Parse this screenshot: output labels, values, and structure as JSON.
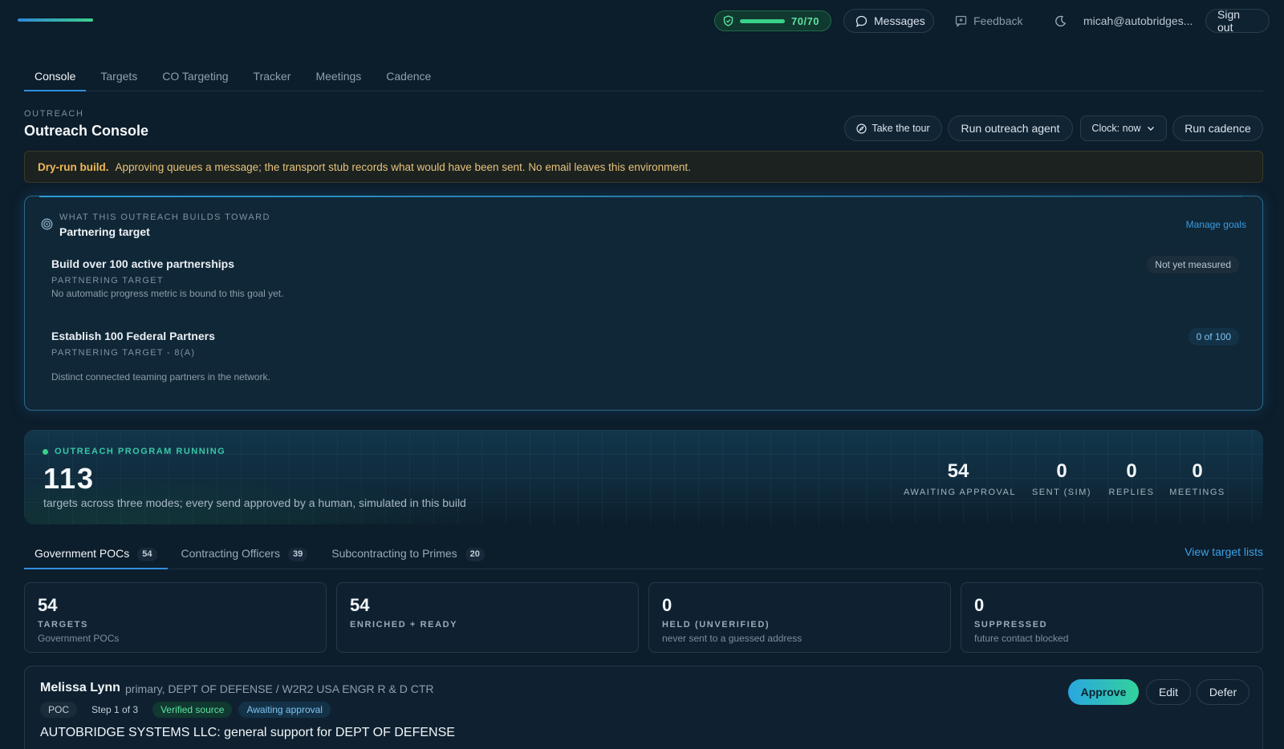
{
  "header": {
    "score": "70/70",
    "score_fill": 1.0,
    "messages_label": "Messages",
    "feedback_label": "Feedback",
    "user_email": "micah@autobridges...",
    "signout_label": "Sign out"
  },
  "tabs": [
    "Console",
    "Targets",
    "CO Targeting",
    "Tracker",
    "Meetings",
    "Cadence"
  ],
  "page": {
    "eyebrow": "OUTREACH",
    "title": "Outreach Console",
    "tour_label": "Take the tour",
    "run_agent_label": "Run outreach agent",
    "clock_label": "Clock: now",
    "run_cadence_label": "Run cadence"
  },
  "notice": {
    "title": "Dry-run build.",
    "text": "Approving queues a message; the transport stub records what would have been sent. No email leaves this environment."
  },
  "goals": {
    "subtitle": "WHAT THIS OUTREACH BUILDS TOWARD",
    "title": "Partnering target",
    "manage_label": "Manage goals",
    "items": [
      {
        "name": "Build over 100 active partnerships",
        "type": "PARTNERING TARGET",
        "desc": "No automatic progress metric is bound to this goal yet.",
        "badge": "Not yet measured"
      },
      {
        "name": "Establish 100 Federal Partners",
        "type": "PARTNERING TARGET - 8(A)",
        "desc": "Distinct connected teaming partners in the network.",
        "badge": "0 of 100"
      }
    ]
  },
  "program": {
    "status": "OUTREACH PROGRAM RUNNING",
    "total": "113",
    "desc": "targets across three modes; every send approved by a human, simulated in this build",
    "stats": [
      {
        "value": "54",
        "label": "AWAITING APPROVAL"
      },
      {
        "value": "0",
        "label": "SENT (SIM)"
      },
      {
        "value": "0",
        "label": "REPLIES"
      },
      {
        "value": "0",
        "label": "MEETINGS"
      }
    ]
  },
  "subtabs": [
    {
      "label": "Government POCs",
      "count": "54"
    },
    {
      "label": "Contracting Officers",
      "count": "39"
    },
    {
      "label": "Subcontracting to Primes",
      "count": "20"
    }
  ],
  "view_lists_label": "View target lists",
  "cards": [
    {
      "value": "54",
      "label": "TARGETS",
      "sub": "Government POCs"
    },
    {
      "value": "54",
      "label": "ENRICHED + READY",
      "sub": ""
    },
    {
      "value": "0",
      "label": "HELD (UNVERIFIED)",
      "sub": "never sent to a guessed address"
    },
    {
      "value": "0",
      "label": "SUPPRESSED",
      "sub": "future contact blocked"
    }
  ],
  "item": {
    "name": "Melissa Lynn",
    "meta": "primary, DEPT OF DEFENSE / W2R2 USA ENGR R & D CTR",
    "chips": [
      "POC",
      "Step 1 of 3",
      "Verified source",
      "Awaiting approval"
    ],
    "subject": "AUTOBRIDGE SYSTEMS LLC: general support for DEPT OF DEFENSE",
    "approve_label": "Approve",
    "edit_label": "Edit",
    "defer_label": "Defer"
  },
  "colors": {
    "accent": "#2f8fdd",
    "success": "#3ad18a",
    "warning": "#f0b85a"
  }
}
